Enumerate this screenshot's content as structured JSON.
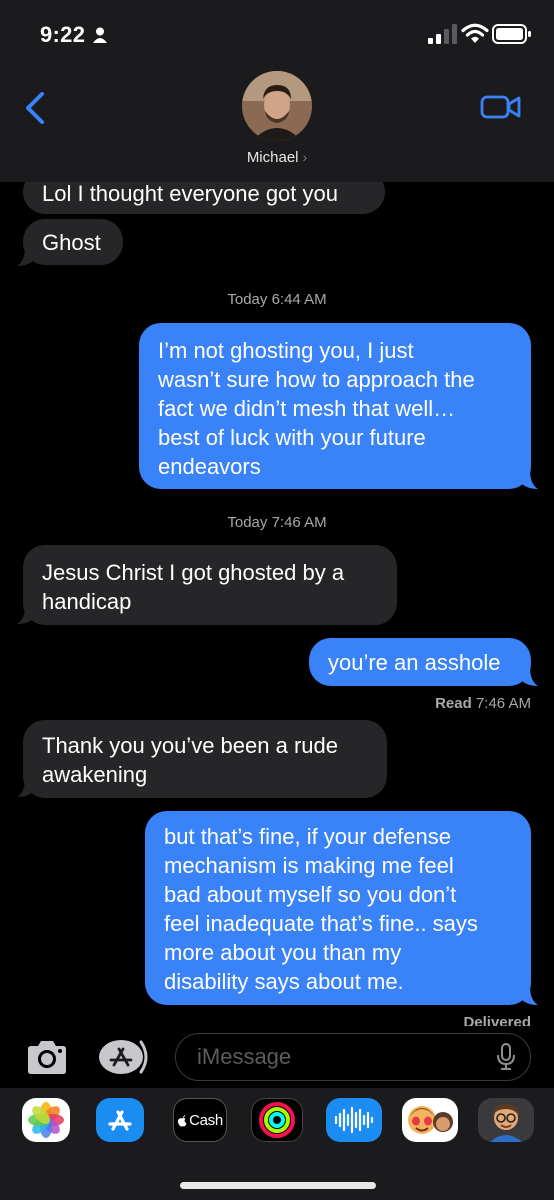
{
  "status_bar": {
    "time": "9:22"
  },
  "header": {
    "contact_name": "Michael",
    "chevron": "›"
  },
  "messages": [
    {
      "dir": "in",
      "text": "Lol I thought everyone got you"
    },
    {
      "dir": "in",
      "text": "Ghost"
    },
    {
      "type": "timestamp",
      "day": "Today",
      "time": "6:44 AM"
    },
    {
      "dir": "out",
      "lines": [
        "I’m not ghosting you, I just",
        "wasn’t sure how to approach the",
        "fact we didn’t mesh that well…",
        "best of luck with your future",
        "endeavors"
      ]
    },
    {
      "type": "timestamp",
      "day": "Today",
      "time": "7:46 AM"
    },
    {
      "dir": "in",
      "lines": [
        "Jesus Christ I got ghosted by a",
        "handicap"
      ]
    },
    {
      "dir": "out",
      "text": "you’re an asshole"
    },
    {
      "type": "receipt",
      "label": "Read",
      "time": "7:46 AM"
    },
    {
      "dir": "in",
      "lines": [
        "Thank you you’ve been a rude",
        "awakening"
      ]
    },
    {
      "dir": "out",
      "lines": [
        "but that’s fine, if your defense",
        "mechanism is making me feel",
        "bad about myself so you don’t",
        "feel inadequate that’s fine.. says",
        "more about you than my",
        "disability says about me."
      ]
    },
    {
      "type": "receipt",
      "label": "Delivered"
    }
  ],
  "input": {
    "placeholder": "iMessage"
  },
  "apps": [
    {
      "name": "Photos",
      "icon": "photos-icon"
    },
    {
      "name": "App Store",
      "icon": "appstore-icon"
    },
    {
      "name": "Apple Cash",
      "label": "Cash",
      "icon": "apple-cash-icon"
    },
    {
      "name": "Activity",
      "icon": "activity-rings-icon"
    },
    {
      "name": "Audio Message",
      "icon": "audio-waveform-icon"
    },
    {
      "name": "Memoji Stickers",
      "icon": "memoji-stickers-icon"
    },
    {
      "name": "Memoji",
      "icon": "memoji-icon"
    }
  ],
  "colors": {
    "outgoing": "#3a82f7",
    "incoming": "#262628",
    "header": "#1b1b1d",
    "accent": "#3a82f7"
  }
}
